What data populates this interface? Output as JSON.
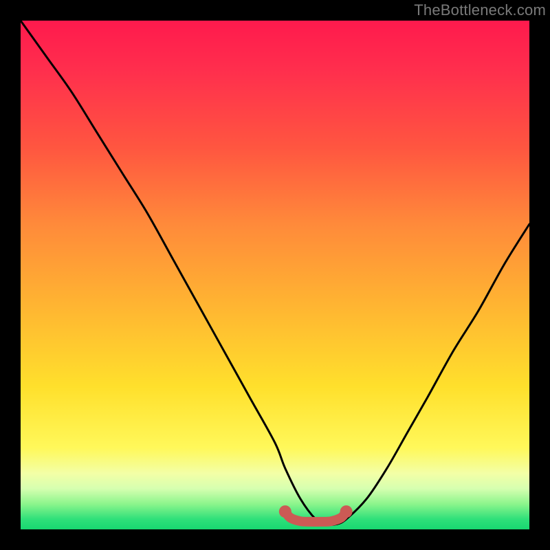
{
  "watermark": "TheBottleneck.com",
  "colors": {
    "background": "#000000",
    "curve": "#000000",
    "marker": "#cc5a55",
    "gradient_top": "#ff1a4d",
    "gradient_mid": "#ffe02c",
    "gradient_bottom": "#18d770"
  },
  "chart_data": {
    "type": "line",
    "title": "",
    "xlabel": "",
    "ylabel": "",
    "xlim": [
      0,
      100
    ],
    "ylim": [
      0,
      100
    ],
    "grid": false,
    "legend": false,
    "series": [
      {
        "name": "bottleneck-curve",
        "x": [
          0,
          5,
          10,
          15,
          20,
          25,
          30,
          35,
          40,
          45,
          50,
          52,
          55,
          58,
          60,
          62,
          64,
          68,
          72,
          76,
          80,
          85,
          90,
          95,
          100
        ],
        "y": [
          100,
          93,
          86,
          78,
          70,
          62,
          53,
          44,
          35,
          26,
          17,
          12,
          6,
          2,
          1,
          1,
          2,
          6,
          12,
          19,
          26,
          35,
          43,
          52,
          60
        ]
      },
      {
        "name": "optimal-range-marker",
        "x": [
          52,
          53,
          55,
          57,
          59,
          61,
          63,
          64
        ],
        "y": [
          3.5,
          2.3,
          1.6,
          1.5,
          1.5,
          1.6,
          2.3,
          3.5
        ]
      }
    ],
    "annotations": []
  }
}
